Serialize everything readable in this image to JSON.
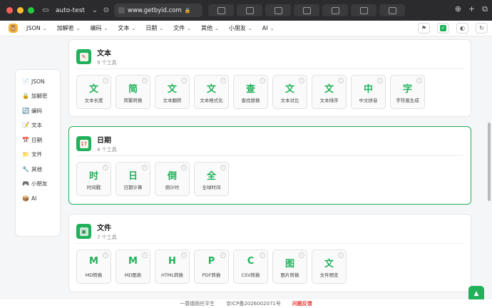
{
  "browser": {
    "tab_title": "auto-test",
    "url": "www.getbyid.com",
    "mini_tabs": [
      "tab1",
      "tab2",
      "tab3",
      "tab4",
      "tab5",
      "tab6",
      "tab7"
    ]
  },
  "nav": {
    "items": [
      {
        "label": "JSON"
      },
      {
        "label": "加解密"
      },
      {
        "label": "编码"
      },
      {
        "label": "文本"
      },
      {
        "label": "日期"
      },
      {
        "label": "文件"
      },
      {
        "label": "其他"
      },
      {
        "label": "小朋友"
      },
      {
        "label": "AI"
      }
    ]
  },
  "sidebar": {
    "items": [
      {
        "label": "JSON",
        "icon": "📄"
      },
      {
        "label": "加解密",
        "icon": "🔒"
      },
      {
        "label": "编码",
        "icon": "🔄"
      },
      {
        "label": "文本",
        "icon": "📝"
      },
      {
        "label": "日期",
        "icon": "📅"
      },
      {
        "label": "文件",
        "icon": "📁"
      },
      {
        "label": "其他",
        "icon": "🔧"
      },
      {
        "label": "小朋友",
        "icon": "🎮"
      },
      {
        "label": "AI",
        "icon": "📦"
      }
    ]
  },
  "sections": [
    {
      "title": "文本",
      "count": "9 个工具",
      "tools": [
        {
          "glyph": "文",
          "label": "文本长度"
        },
        {
          "glyph": "简",
          "label": "简繁转换"
        },
        {
          "glyph": "文",
          "label": "文本翻转"
        },
        {
          "glyph": "文",
          "label": "文本格式化"
        },
        {
          "glyph": "查",
          "label": "查找替换"
        },
        {
          "glyph": "文",
          "label": "文本对比"
        },
        {
          "glyph": "文",
          "label": "文本排序"
        },
        {
          "glyph": "中",
          "label": "中文拼音"
        },
        {
          "glyph": "字",
          "label": "字符画生成"
        }
      ]
    },
    {
      "title": "日期",
      "count": "4 个工具",
      "tools": [
        {
          "glyph": "时",
          "label": "时间戳"
        },
        {
          "glyph": "日",
          "label": "日期计算"
        },
        {
          "glyph": "倒",
          "label": "倒计时"
        },
        {
          "glyph": "全",
          "label": "全球时间"
        }
      ]
    },
    {
      "title": "文件",
      "count": "7 个工具",
      "tools": [
        {
          "glyph": "M",
          "label": "MD转换"
        },
        {
          "glyph": "M",
          "label": "MD图表"
        },
        {
          "glyph": "H",
          "label": "HTML转换"
        },
        {
          "glyph": "P",
          "label": "PDF转换"
        },
        {
          "glyph": "C",
          "label": "CSV转换"
        },
        {
          "glyph": "图",
          "label": "图片转换"
        },
        {
          "glyph": "文",
          "label": "文件预览"
        }
      ]
    }
  ],
  "footer": {
    "text1": "一蓑烟雨任平生",
    "text2": "京ICP备2026002071号",
    "link": "问题反馈"
  },
  "colors": {
    "accent": "#20b15a",
    "link": "#e53935"
  }
}
